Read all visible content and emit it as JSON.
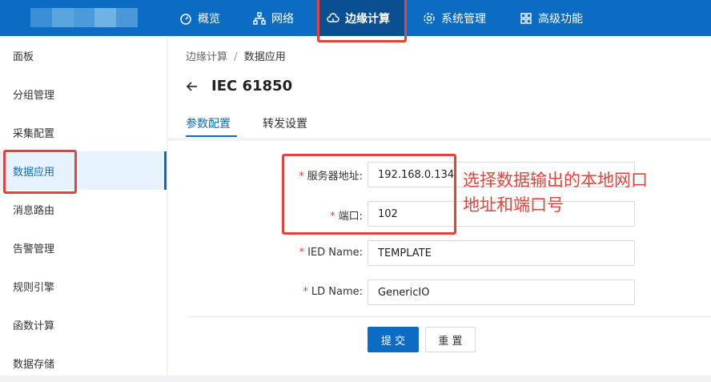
{
  "logo": {
    "colors": [
      "#3b8fd6",
      "#5aa5e0",
      "#4b9bdc",
      "#6fb2e6",
      "#4a98da"
    ]
  },
  "topnav": [
    {
      "label": "概览",
      "icon": "dashboard-icon"
    },
    {
      "label": "网络",
      "icon": "network-icon"
    },
    {
      "label": "边缘计算",
      "icon": "cloud-icon",
      "active": true
    },
    {
      "label": "系统管理",
      "icon": "gear-icon"
    },
    {
      "label": "高级功能",
      "icon": "grid-icon"
    }
  ],
  "sidebar": {
    "items": [
      {
        "label": "面板"
      },
      {
        "label": "分组管理"
      },
      {
        "label": "采集配置"
      },
      {
        "label": "数据应用",
        "active": true
      },
      {
        "label": "消息路由"
      },
      {
        "label": "告警管理"
      },
      {
        "label": "规则引擎"
      },
      {
        "label": "函数计算"
      },
      {
        "label": "数据存储"
      }
    ]
  },
  "breadcrumb": {
    "parent": "边缘计算",
    "separator": "/",
    "current": "数据应用"
  },
  "page": {
    "title": "IEC 61850"
  },
  "tabs": [
    {
      "label": "参数配置",
      "active": true
    },
    {
      "label": "转发设置"
    }
  ],
  "form": {
    "fields": [
      {
        "label": "服务器地址:",
        "value": "192.168.0.134",
        "required": "*"
      },
      {
        "label": "端口:",
        "value": "102",
        "required": "*"
      },
      {
        "label": "IED Name:",
        "value": "TEMPLATE",
        "required": "*"
      },
      {
        "label": "LD Name:",
        "value": "GenericIO",
        "required": "*"
      }
    ],
    "submit_label": "提 交",
    "reset_label": "重 置"
  },
  "annotation": {
    "line1": "选择数据输出的本地网口",
    "line2": "地址和端口号"
  },
  "colors": {
    "brand": "#0c6bc2",
    "highlight": "#e8413a"
  }
}
